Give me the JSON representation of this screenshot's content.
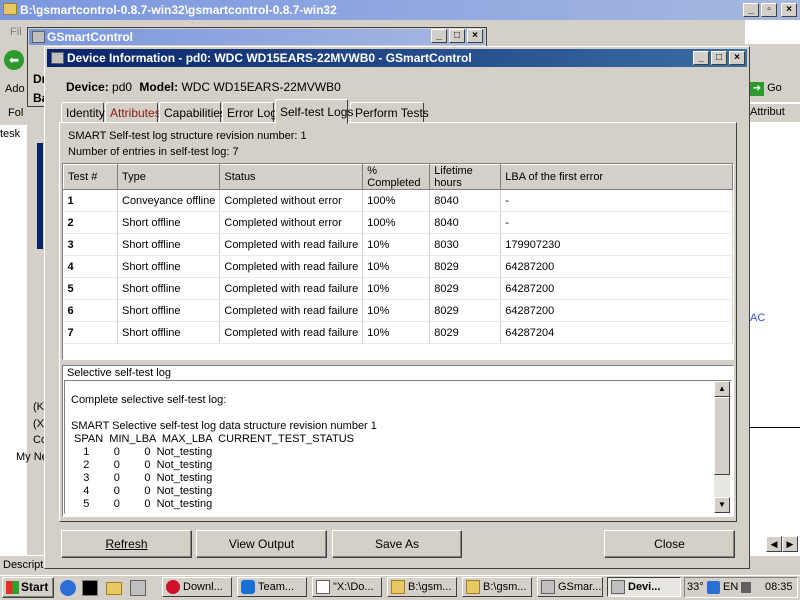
{
  "bg_window": {
    "title": "B:\\gsmartcontrol-0.8.7-win32\\gsmartcontrol-0.8.7-win32",
    "menu_fragment": "Fil",
    "side_labels": [
      "Fol",
      "Ado",
      "tesk",
      "Descripti"
    ],
    "right_go": "Go",
    "right_attrib": "Attribut",
    "right_ac": "AC",
    "tree_items": [
      "(K",
      "(X",
      "Co",
      "My Ne"
    ]
  },
  "gsc_window": {
    "title": "GSmartControl",
    "frag_top": "Dr",
    "frag_mid": "Ba"
  },
  "dialog": {
    "title": "Device Information - pd0: WDC WD15EARS-22MVWB0 - GSmartControl",
    "device_label": "Device:",
    "device_value": "pd0",
    "model_label": "Model:",
    "model_value": "WDC WD15EARS-22MVWB0",
    "tabs": [
      "Identity",
      "Attributes",
      "Capabilities",
      "Error Log",
      "Self-test Logs",
      "Perform Tests"
    ],
    "active_tab": "Self-test Logs",
    "revision_line": "SMART Self-test log structure revision number: 1",
    "entries_line": "Number of entries in self-test log: 7",
    "columns": [
      "Test #",
      "Type",
      "Status",
      "% Completed",
      "Lifetime hours",
      "LBA of the first error"
    ],
    "rows": [
      [
        "1",
        "Conveyance offline",
        "Completed without error",
        "100%",
        "8040",
        "-"
      ],
      [
        "2",
        "Short offline",
        "Completed without error",
        "100%",
        "8040",
        "-"
      ],
      [
        "3",
        "Short offline",
        "Completed with read failure",
        "10%",
        "8030",
        "179907230"
      ],
      [
        "4",
        "Short offline",
        "Completed with read failure",
        "10%",
        "8029",
        "64287200"
      ],
      [
        "5",
        "Short offline",
        "Completed with read failure",
        "10%",
        "8029",
        "64287200"
      ],
      [
        "6",
        "Short offline",
        "Completed with read failure",
        "10%",
        "8029",
        "64287200"
      ],
      [
        "7",
        "Short offline",
        "Completed with read failure",
        "10%",
        "8029",
        "64287204"
      ]
    ],
    "selective_title": "Selective self-test log",
    "selective_lines": [
      "Complete selective self-test log:",
      "",
      "SMART Selective self-test log data structure revision number 1",
      " SPAN  MIN_LBA  MAX_LBA  CURRENT_TEST_STATUS",
      "    1        0        0  Not_testing",
      "    2        0        0  Not_testing",
      "    3        0        0  Not_testing",
      "    4        0        0  Not_testing",
      "    5        0        0  Not_testing"
    ],
    "buttons": {
      "refresh": "Refresh",
      "view_output": "View Output",
      "save_as": "Save As",
      "close": "Close"
    }
  },
  "taskbar": {
    "start": "Start",
    "tasks": [
      "Downl...",
      "Team...",
      "\"X:\\Do...",
      "B:\\gsm...",
      "B:\\gsm...",
      "GSmar...",
      "Devi..."
    ],
    "temp": "33°",
    "lang": "EN",
    "clock": "08:35"
  },
  "colors": {
    "title_active": "#0a246a",
    "title_inactive": "#7a96df",
    "attributes_tab_text": "#8b1a1a"
  }
}
